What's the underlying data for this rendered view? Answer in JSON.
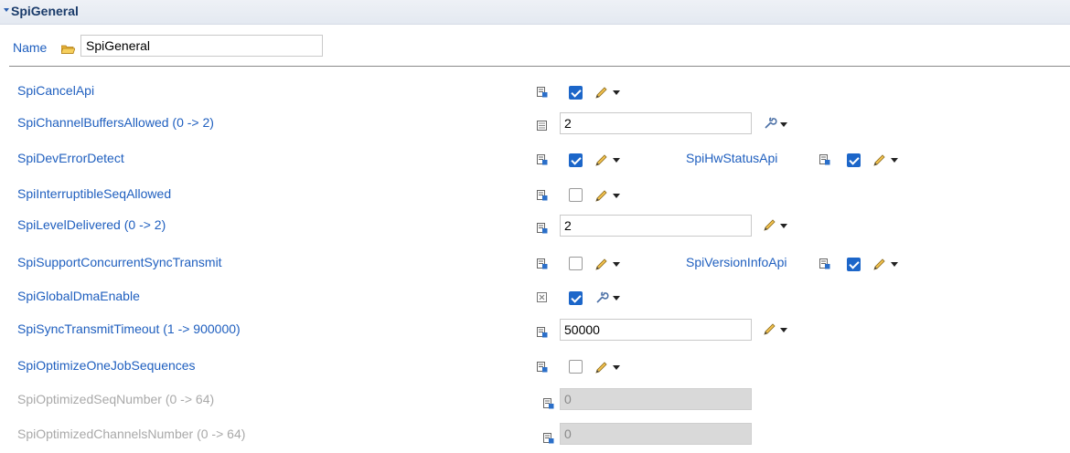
{
  "section": {
    "title": "SpiGeneral"
  },
  "name": {
    "label": "Name",
    "value": "SpiGeneral"
  },
  "rows": [
    {
      "label": "SpiCancelApi",
      "checked": true
    },
    {
      "label": "SpiChannelBuffersAllowed (0 -> 2)",
      "value": "2"
    },
    {
      "label": "SpiDevErrorDetect",
      "checked": true,
      "right_label": "SpiHwStatusApi",
      "right_checked": true
    },
    {
      "label": "SpiInterruptibleSeqAllowed",
      "checked": false
    },
    {
      "label": "SpiLevelDelivered (0 -> 2)",
      "value": "2"
    },
    {
      "label": "SpiSupportConcurrentSyncTransmit",
      "checked": false,
      "right_label": "SpiVersionInfoApi",
      "right_checked": true
    },
    {
      "label": "SpiGlobalDmaEnable",
      "checked": true
    },
    {
      "label": "SpiSyncTransmitTimeout (1 -> 900000)",
      "value": "50000"
    },
    {
      "label": "SpiOptimizeOneJobSequences",
      "checked": false
    },
    {
      "label": "SpiOptimizedSeqNumber (0 -> 64)",
      "value": "0",
      "disabled": true
    },
    {
      "label": "SpiOptimizedChannelsNumber (0 -> 64)",
      "value": "0",
      "disabled": true
    }
  ],
  "icons": {
    "section_toggle": "chevron-down-icon",
    "folder": "folder-icon",
    "param": "parameter-icon",
    "edit": "pencil-icon",
    "derived": "wrench-icon",
    "dropdown": "dropdown-arrow-icon"
  },
  "colors": {
    "label": "#1f5fbf",
    "checkbox_on": "#1c66c9",
    "disabled_text": "#a9a9a9",
    "header_bg": "#e4e9f1"
  }
}
